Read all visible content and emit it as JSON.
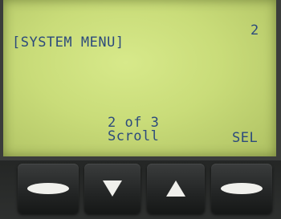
{
  "screen": {
    "title": "[SYSTEM MENU]",
    "page_number": "2",
    "position": "2 of 3",
    "scroll_label": "Scroll",
    "select_label": "SEL"
  },
  "buttons": [
    {
      "icon": "dash-icon"
    },
    {
      "icon": "arrow-down-icon"
    },
    {
      "icon": "arrow-up-icon"
    },
    {
      "icon": "dash-icon"
    }
  ],
  "colors": {
    "lcd_background": "#c9dc79",
    "lcd_text": "#2c4a7c",
    "button": "#232525",
    "button_glyph": "#f0f0ec"
  }
}
